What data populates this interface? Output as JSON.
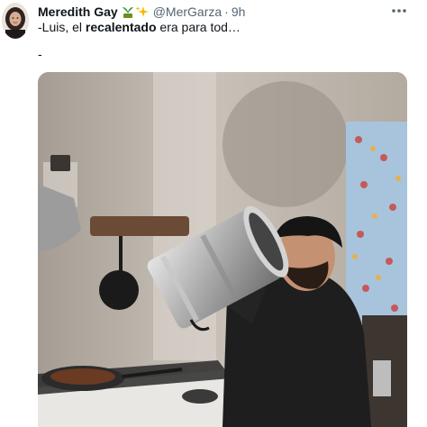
{
  "author": {
    "display_name": "Meredith Gay",
    "name_emojis": [
      "plant-icon",
      "sparkles-icon"
    ],
    "handle": "@MerGarza",
    "separator": "·",
    "time": "9h"
  },
  "more_icon": "more-horizontal-icon",
  "text": {
    "prefix": "-Luis, el ",
    "bold": "recalentado",
    "suffix": " era para tod…",
    "second_line": "-"
  },
  "media": {
    "kind": "photo",
    "icon": "image"
  },
  "colors": {
    "name": "#0f1419",
    "secondary": "#536471",
    "background": "#ffffff"
  }
}
